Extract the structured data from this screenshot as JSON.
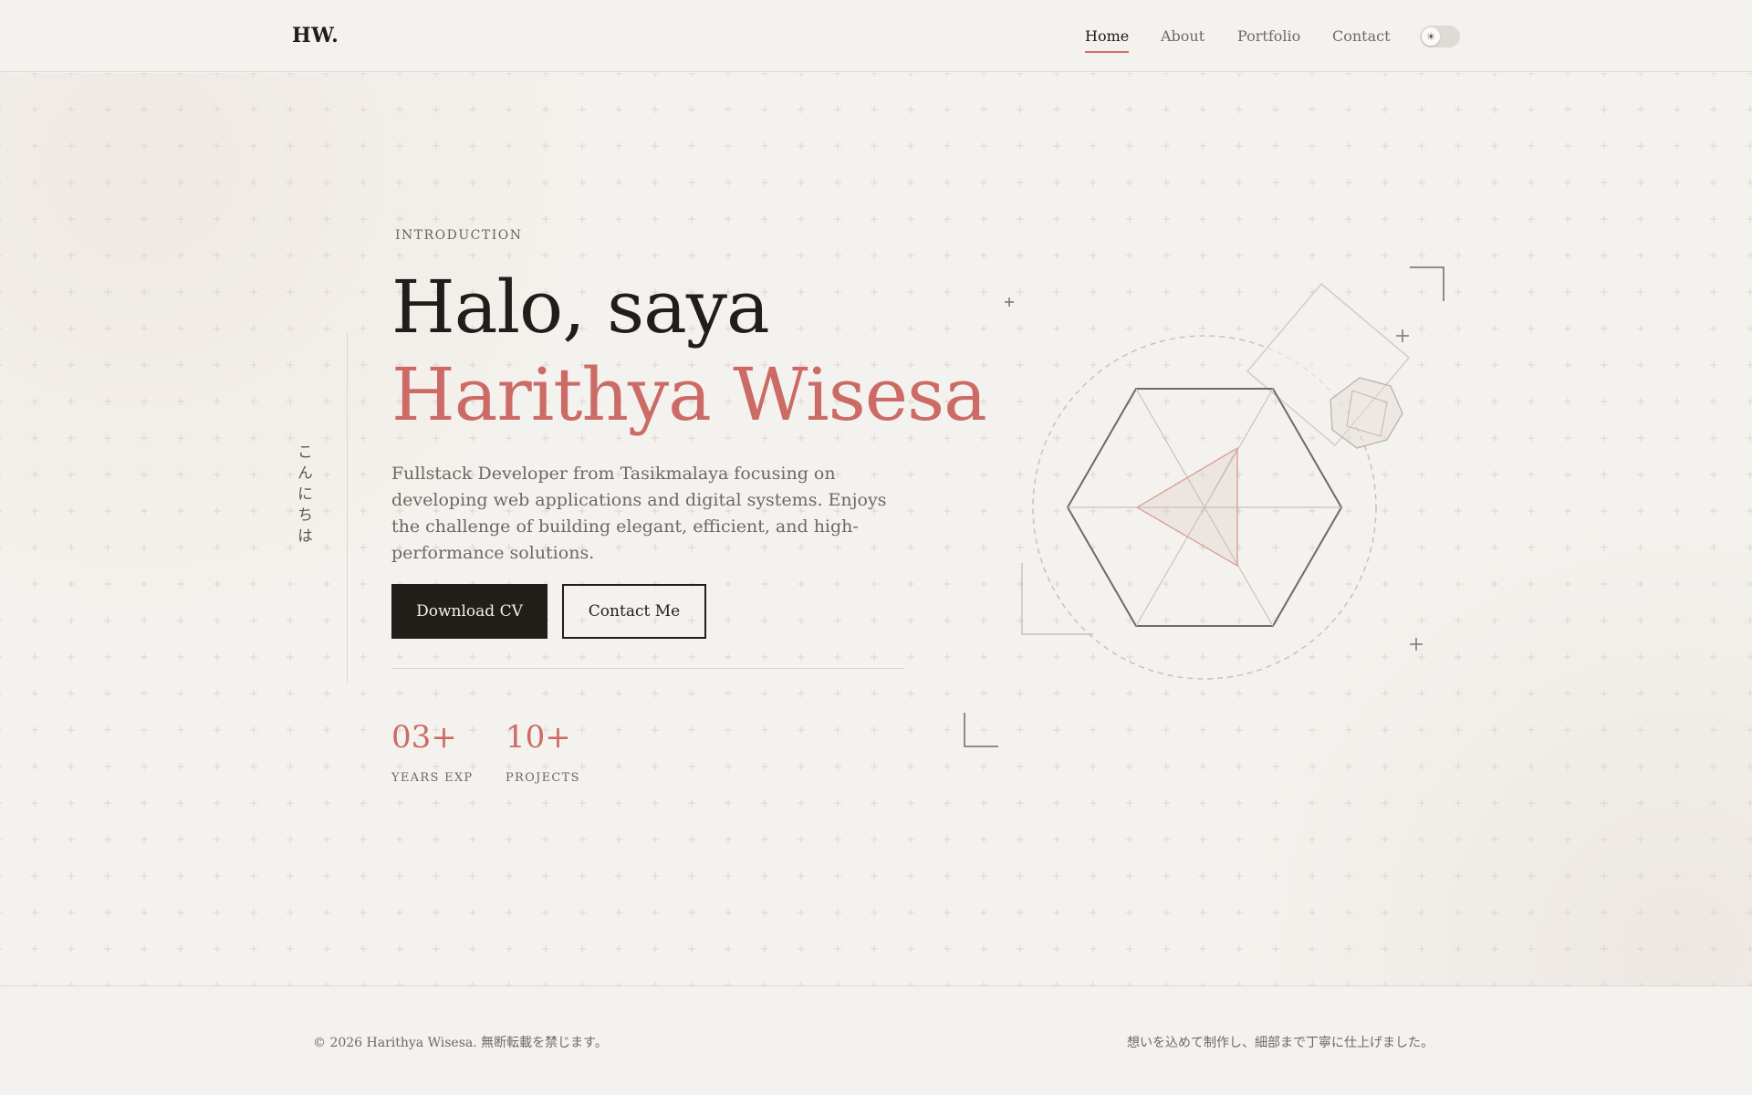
{
  "header": {
    "logo": "HW.",
    "nav": [
      {
        "label": "Home",
        "active": true
      },
      {
        "label": "About",
        "active": false
      },
      {
        "label": "Portfolio",
        "active": false
      },
      {
        "label": "Contact",
        "active": false
      }
    ],
    "theme_toggle_icon": "sun-icon"
  },
  "hero": {
    "vertical_text": "こんにちは",
    "intro_label": "INTRODUCTION",
    "title_line1": "Halo, saya",
    "title_line2": "Harithya Wisesa",
    "description": "Fullstack Developer from Tasikmalaya focusing on developing web applications and digital systems. Enjoys the challenge of building elegant, efficient, and high-performance solutions.",
    "primary_button": "Download CV",
    "secondary_button": "Contact Me",
    "stats": [
      {
        "value": "03+",
        "label": "YEARS EXP"
      },
      {
        "value": "10+",
        "label": "PROJECTS"
      }
    ]
  },
  "footer": {
    "left": "© 2026 Harithya Wisesa. 無断転載を禁じます。",
    "right": "想いを込めて制作し、細部まで丁寧に仕上げました。"
  },
  "colors": {
    "accent": "#cc6b66",
    "dark": "#221e1a",
    "background": "#f4f2ee"
  }
}
